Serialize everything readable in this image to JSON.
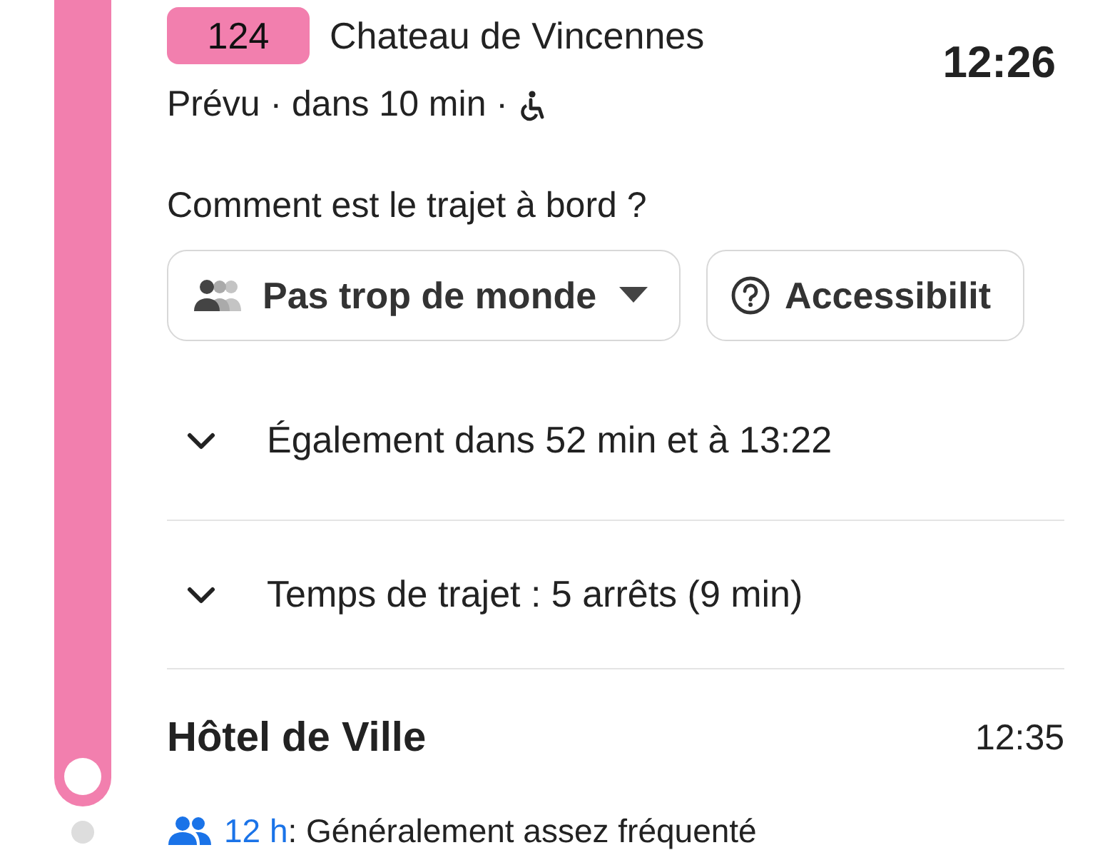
{
  "line": {
    "number": "124",
    "color": "#f27fae",
    "destination": "Chateau de Vincennes"
  },
  "departure_time": "12:26",
  "status": {
    "text": "Prévu · dans 10 min ·",
    "wheelchair_accessible": true
  },
  "question": "Comment est le trajet à bord ?",
  "chips": [
    {
      "kind": "crowd",
      "label": "Pas trop de monde",
      "dropdown": true
    },
    {
      "kind": "help",
      "label": "Accessibilit",
      "dropdown": false
    }
  ],
  "details": [
    {
      "label": "Également dans 52 min et à 13:22",
      "expanded": false
    },
    {
      "label": "Temps de trajet : 5 arrêts (9 min)",
      "expanded": false
    }
  ],
  "stop": {
    "name": "Hôtel de Ville",
    "time": "12:35"
  },
  "crowd": {
    "hour": "12 h",
    "text": ": Généralement assez fréquenté"
  }
}
